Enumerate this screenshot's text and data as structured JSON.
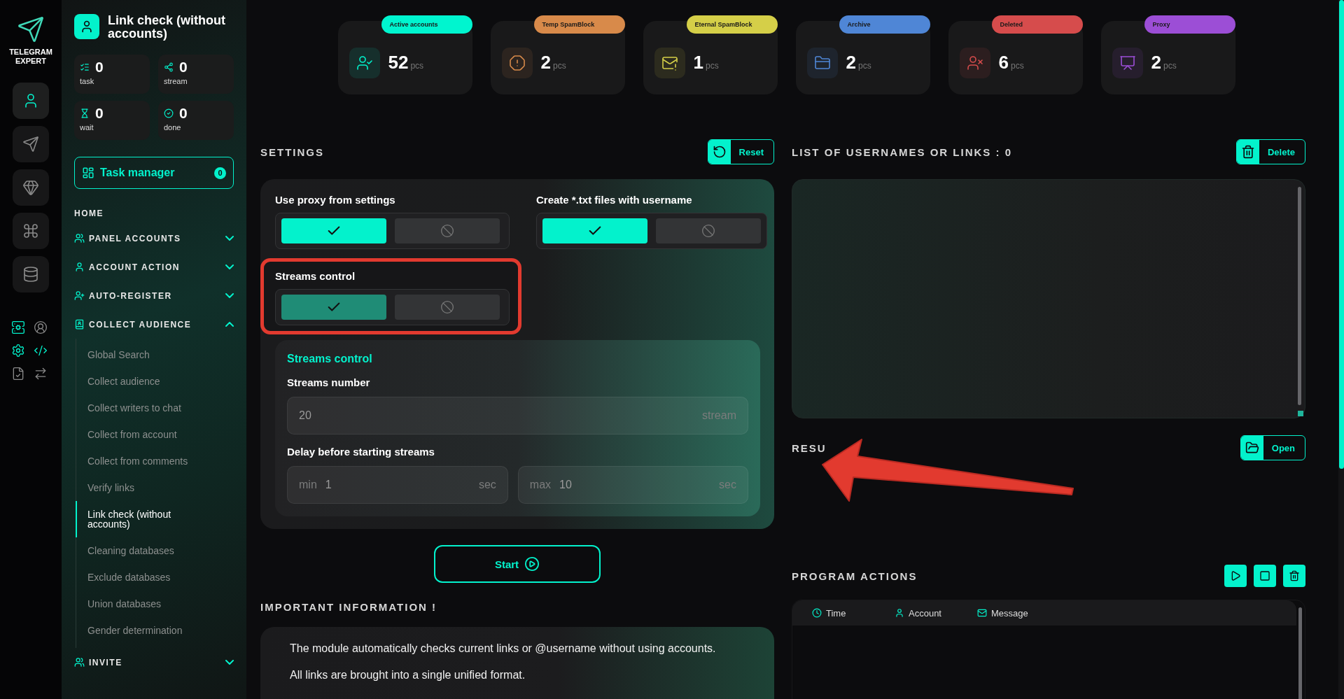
{
  "brand": {
    "name": "TELEGRAM EXPERT"
  },
  "rail": {
    "items": [
      {
        "selected": true
      },
      {
        "selected": false
      },
      {
        "selected": false
      },
      {
        "selected": false
      },
      {
        "selected": false
      }
    ],
    "tools": [
      {
        "active": true
      },
      {
        "active": false
      },
      {
        "active": true
      },
      {
        "active": true
      },
      {
        "active": false
      },
      {
        "active": false
      }
    ]
  },
  "sidebar": {
    "title": "Link check (without accounts)",
    "counters": [
      {
        "value": "0",
        "label": "task"
      },
      {
        "value": "0",
        "label": "stream"
      },
      {
        "value": "0",
        "label": "wait"
      },
      {
        "value": "0",
        "label": "done"
      }
    ],
    "task_manager": {
      "label": "Task manager",
      "count": "0"
    },
    "nav": [
      {
        "label": "HOME",
        "kind": "link"
      },
      {
        "label": "PANEL ACCOUNTS",
        "kind": "section",
        "expanded": false
      },
      {
        "label": "ACCOUNT ACTION",
        "kind": "section",
        "expanded": false
      },
      {
        "label": "AUTO-REGISTER",
        "kind": "section",
        "expanded": false
      },
      {
        "label": "COLLECT AUDIENCE",
        "kind": "section",
        "expanded": true,
        "children": [
          {
            "label": "Global Search",
            "selected": false
          },
          {
            "label": "Collect audience",
            "selected": false
          },
          {
            "label": "Collect writers to chat",
            "selected": false
          },
          {
            "label": "Collect from account",
            "selected": false
          },
          {
            "label": "Collect from comments",
            "selected": false
          },
          {
            "label": "Verify links",
            "selected": false
          },
          {
            "label": "Link check (without accounts)",
            "selected": true
          },
          {
            "label": "Cleaning databases",
            "selected": false
          },
          {
            "label": "Exclude databases",
            "selected": false
          },
          {
            "label": "Union databases",
            "selected": false
          },
          {
            "label": "Gender determination",
            "selected": false
          }
        ]
      },
      {
        "label": "INVITE",
        "kind": "section",
        "expanded": false
      }
    ]
  },
  "stats": [
    {
      "label": "Active accounts",
      "value": "52",
      "unit": "pcs",
      "color": "#00f5cf"
    },
    {
      "label": "Temp SpamBlock",
      "value": "2",
      "unit": "pcs",
      "color": "#d88a4a"
    },
    {
      "label": "Eternal SpamBlock",
      "value": "1",
      "unit": "pcs",
      "color": "#d5cf48"
    },
    {
      "label": "Archive",
      "value": "2",
      "unit": "pcs",
      "color": "#4f86d6"
    },
    {
      "label": "Deleted",
      "value": "6",
      "unit": "pcs",
      "color": "#d64c4c"
    },
    {
      "label": "Proxy",
      "value": "2",
      "unit": "pcs",
      "color": "#9c4ed6"
    }
  ],
  "settings": {
    "title": "SETTINGS",
    "reset": "Reset",
    "options": [
      {
        "label": "Use proxy from settings",
        "on": true,
        "muted": false,
        "highlighted": false
      },
      {
        "label": "Create *.txt files with username",
        "on": true,
        "muted": false,
        "highlighted": false
      },
      {
        "label": "Streams control",
        "on": true,
        "muted": true,
        "highlighted": true
      }
    ],
    "streams": {
      "title": "Streams control",
      "number_label": "Streams number",
      "number": {
        "value": "20",
        "unit": "stream"
      },
      "delay_label": "Delay before starting streams",
      "delay": [
        {
          "prefix": "min",
          "value": "1",
          "unit": "sec"
        },
        {
          "prefix": "max",
          "value": "10",
          "unit": "sec"
        }
      ]
    }
  },
  "start": "Start",
  "info": {
    "title": "IMPORTANT INFORMATION !",
    "lines": [
      "The module automatically checks current links or @username without using accounts.",
      "All links are brought into a single unified format."
    ]
  },
  "list": {
    "title": "LIST OF USERNAMES OR LINKS : 0",
    "delete": "Delete"
  },
  "results": {
    "title": "RESU",
    "open": "Open"
  },
  "actions": {
    "title": "PROGRAM ACTIONS",
    "columns": [
      "Time",
      "Account",
      "Message"
    ]
  }
}
